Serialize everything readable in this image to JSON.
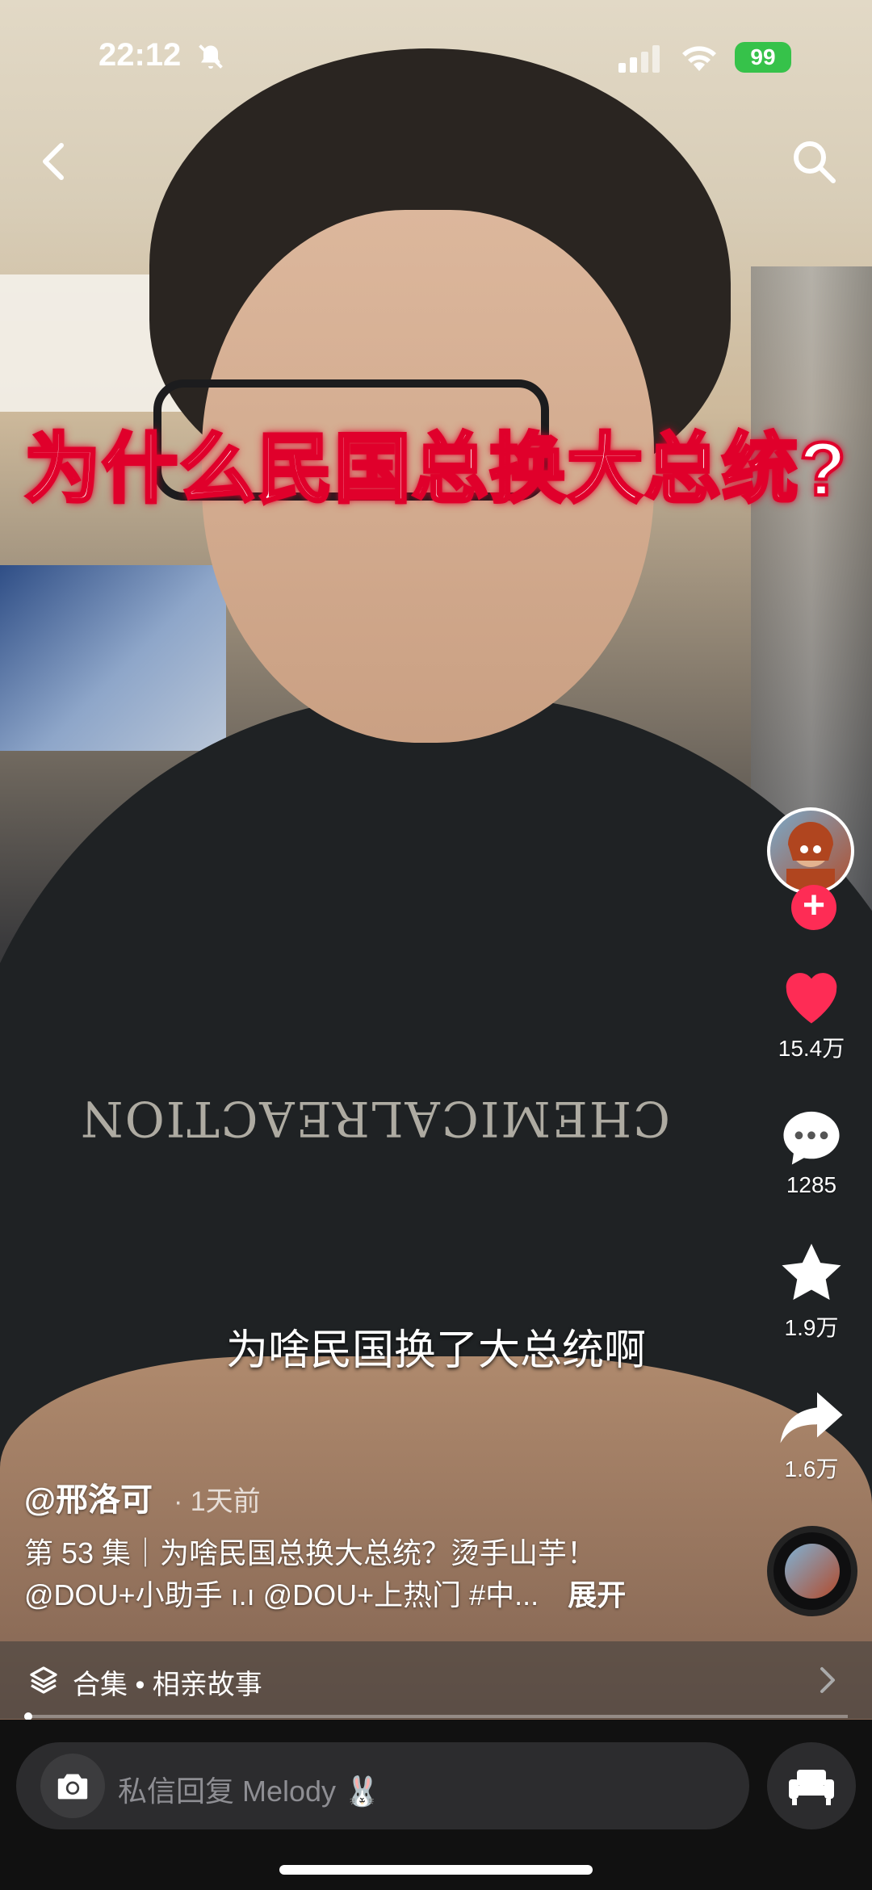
{
  "status_bar": {
    "time": "22:12",
    "battery": "99"
  },
  "video": {
    "title_overlay": "为什么民国总换大总统?",
    "subtitle": "为啥民国换了大总统啊",
    "shirt_text": "CHEMICALREACTION"
  },
  "actions": {
    "likes": "15.4万",
    "comments": "1285",
    "favorites": "1.9万",
    "shares": "1.6万",
    "follow_symbol": "+"
  },
  "caption": {
    "author": "@邢洛可",
    "time_ago": "· 1天前",
    "line1": "第 53 集｜为啥民国总换大总统？烫手山芋！",
    "line2": "@DOU+小助手 ı.ı @DOU+上热门 #中...",
    "expand": "展开"
  },
  "collection": {
    "label": "合集 • 相亲故事"
  },
  "input": {
    "placeholder": "私信回复 Melody 🐰"
  },
  "colors": {
    "accent": "#fe2c55",
    "battery": "#36c24a",
    "title_stroke": "#e0002b"
  },
  "icons": [
    "back-icon",
    "search-icon",
    "heart-icon",
    "comment-icon",
    "star-icon",
    "share-icon",
    "camera-icon",
    "sofa-icon",
    "layers-icon",
    "chevron-right-icon",
    "bell-mute-icon",
    "wifi-icon",
    "signal-icon"
  ]
}
